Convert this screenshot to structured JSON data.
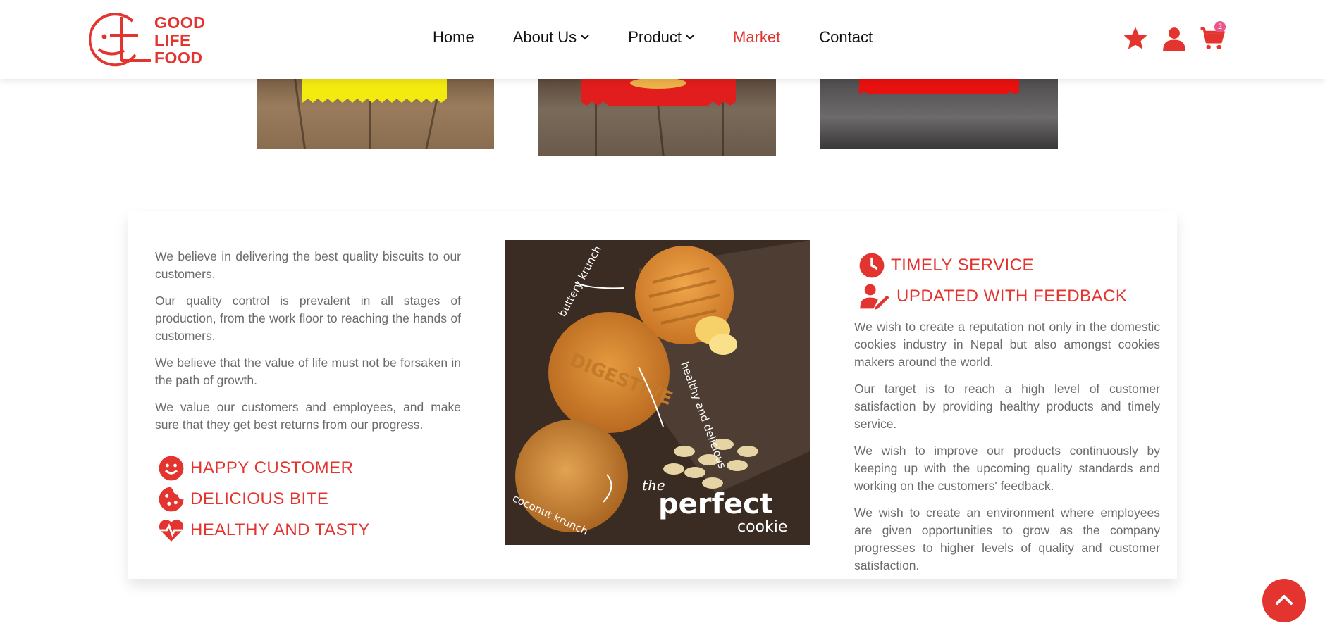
{
  "brand": {
    "line1": "GOOD",
    "line2": "LIFE",
    "line3": "FOOD"
  },
  "nav": {
    "items": [
      "Home",
      "About Us",
      "Product",
      "Market",
      "Contact"
    ],
    "active": "Market"
  },
  "header_icons": [
    "star-icon",
    "user-icon",
    "cart-icon"
  ],
  "cart": {
    "count": "2"
  },
  "left": {
    "paragraphs": [
      "We believe in delivering the best quality biscuits to our customers.",
      "Our quality control is prevalent in all stages of production, from the work floor to reaching the hands of customers.",
      "We believe that the value of life must not be forsaken in the path of growth.",
      "We value our customers and employees, and make sure that they get best returns from our progress."
    ],
    "features": [
      "HAPPY CUSTOMER",
      "DELICIOUS BITE",
      "HEALTHY AND TASTY"
    ]
  },
  "image": {
    "caption_small": "the",
    "caption_big": "perfect",
    "caption_end": "cookie",
    "label_1": "buttery krunch",
    "label_2": "healthy and delicious",
    "label_3": "coconut krunch",
    "stamp": "DIGESTIVE"
  },
  "right": {
    "features": [
      "TIMELY SERVICE",
      "UPDATED WITH FEEDBACK"
    ],
    "paragraphs": [
      "We wish to create a reputation not only in the domestic cookies industry in Nepal but also amongst cookies makers around the world.",
      "Our target is to reach a high level of customer satisfaction by providing healthy products and timely service.",
      "We wish to improve our products continuously by keeping up with the upcoming quality standards and working on the customers' feedback.",
      "We wish to create an environment where employees are given opportunities to grow as the company progresses to higher levels of quality and customer satisfaction."
    ]
  },
  "colors": {
    "brand_red": "#e3342f",
    "badge_pink": "#e8578a",
    "text_gray": "#6b6b6b"
  }
}
